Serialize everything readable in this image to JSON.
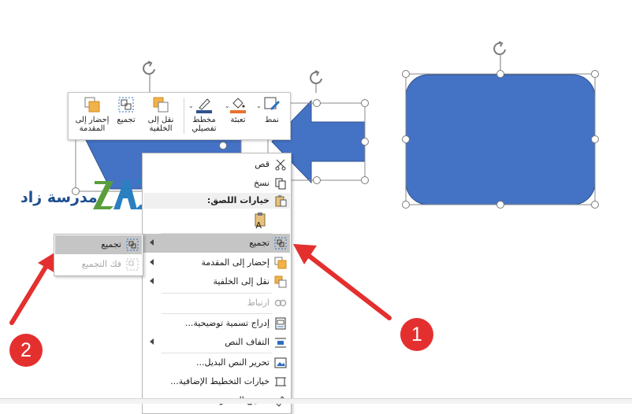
{
  "toolbar": {
    "style_label": "نمط",
    "fill_label": "تعبئة",
    "outline_label": "مخطط تفصيلي",
    "group_label": "تجميع",
    "send_backward_label": "نقل إلى الخلفية",
    "bring_forward_label": "إحضار إلى المقدمة"
  },
  "context_menu": {
    "cut": "قص",
    "copy": "نسخ",
    "paste_options": "خيارات اللصق:",
    "group": "تجميع",
    "bring_to_front": "إحضار إلى المقدمة",
    "send_to_back": "نقل إلى الخلفية",
    "link": "ارتباط",
    "insert_caption": "إدراج تسمية توضيحية...",
    "wrap_text": "التفاف النص",
    "edit_alt_text": "تحرير النص البديل...",
    "more_layout_options": "خيارات التخطيط الإضافية...",
    "format_object": "تنسيق العنصر..."
  },
  "submenu": {
    "group": "تجميع",
    "ungroup": "فك التجميع"
  },
  "logo": {
    "text": "مدرسة زاد",
    "mark": "ZAD"
  },
  "badges": {
    "one": "1",
    "two": "2"
  },
  "colors": {
    "shape_fill": "#4472c4",
    "shape_stroke": "#2f528f",
    "annotation_red": "#e3302f",
    "menu_highlight": "#c5c5c5"
  }
}
